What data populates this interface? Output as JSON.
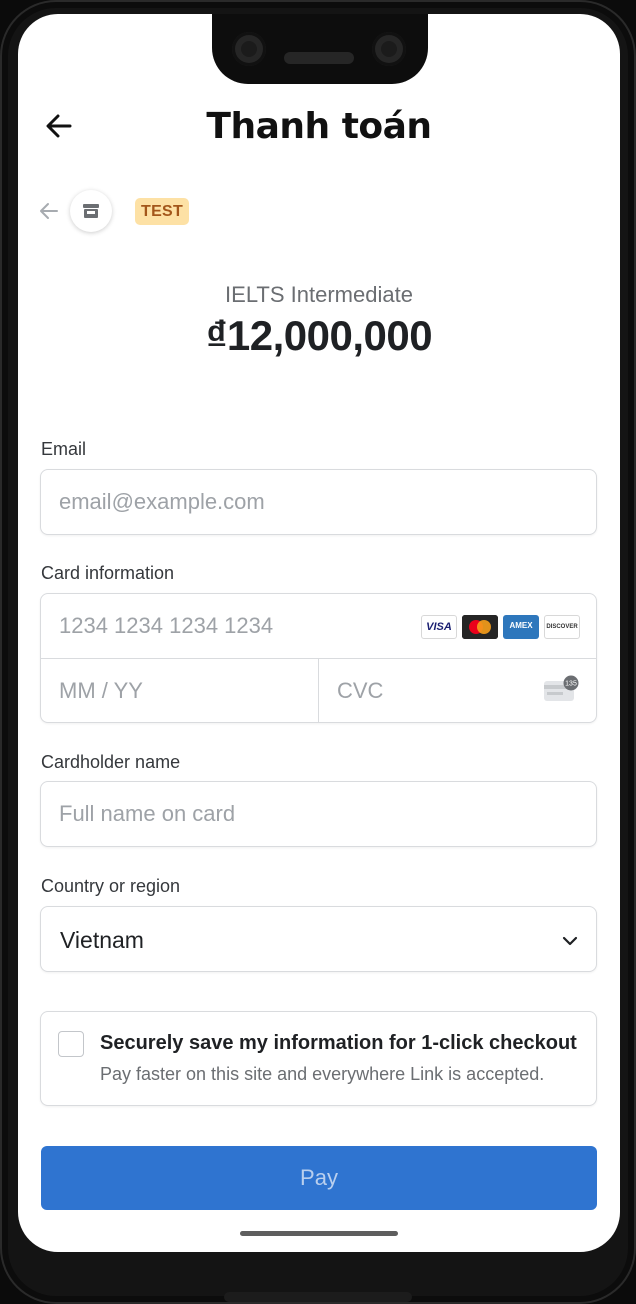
{
  "header": {
    "title": "Thanh toán",
    "back_icon": "arrow-left-icon"
  },
  "merchant": {
    "back_icon": "arrow-left-icon",
    "avatar_icon": "store-icon",
    "badge": "TEST"
  },
  "summary": {
    "product": "IELTS Intermediate",
    "price": "₫12,000,000"
  },
  "form": {
    "email": {
      "label": "Email",
      "placeholder": "email@example.com",
      "value": ""
    },
    "card": {
      "label": "Card information",
      "number_placeholder": "1234 1234 1234 1234",
      "expiry_placeholder": "MM / YY",
      "cvc_placeholder": "CVC",
      "brands": [
        "VISA",
        "mastercard",
        "AMEX",
        "DISCOVER"
      ],
      "brand_icons": [
        "visa-icon",
        "mastercard-icon",
        "amex-icon",
        "discover-icon"
      ],
      "cvc_hint": "135",
      "cvc_icon": "card-cvc-icon"
    },
    "name": {
      "label": "Cardholder name",
      "placeholder": "Full name on card",
      "value": ""
    },
    "country": {
      "label": "Country or region",
      "value": "Vietnam",
      "icon": "chevron-down-icon"
    }
  },
  "link": {
    "title": "Securely save my information for 1-click checkout",
    "subtitle": "Pay faster on this site and everywhere Link is accepted.",
    "checked": false
  },
  "pay_button": {
    "label": "Pay"
  },
  "colors": {
    "primary": "#2f74d0",
    "badge_bg": "#fde1a5",
    "badge_text": "#a3561a",
    "border": "#d9dbde"
  }
}
